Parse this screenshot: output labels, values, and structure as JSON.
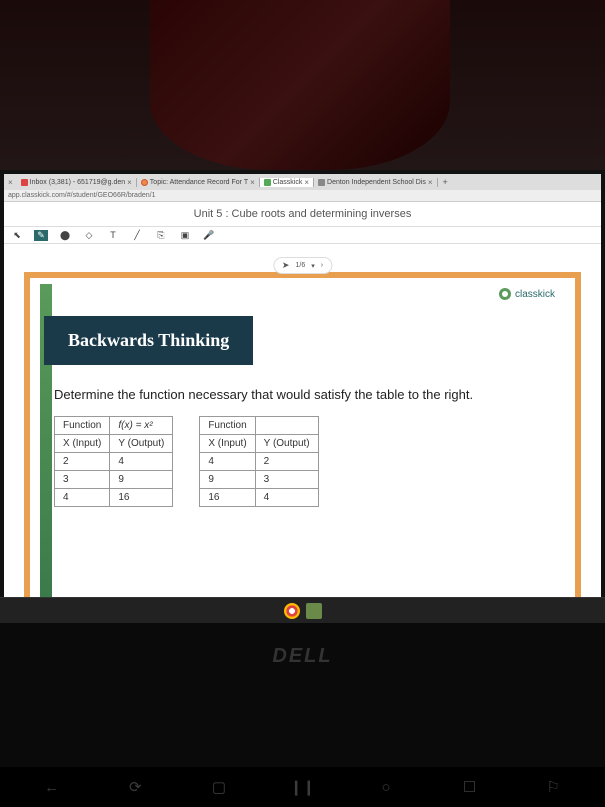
{
  "tabs": {
    "t0": {
      "label": "Inbox (3,381) - 651719@g.den",
      "close": "×"
    },
    "t1": {
      "label": "Topic: Attendance Record For T",
      "close": "×"
    },
    "t2": {
      "label": "Classkick",
      "close": "×"
    },
    "t3": {
      "label": "Denton Independent School Dis",
      "close": "×"
    },
    "plus": "+"
  },
  "url": "app.classkick.com/#/student/GEO66R/braden/1",
  "page_title": "Unit 5 : Cube roots and determining inverses",
  "toolbar": {
    "pointer": "⬉",
    "pen": "✎",
    "highlighter": "⬤",
    "eraser": "◇",
    "text": "T",
    "line": "╱",
    "link": "⎘",
    "image": "▣",
    "mic": "🎤"
  },
  "page_nav": {
    "cursor": "➤",
    "label": "1/6",
    "dropdown": "▾",
    "next": "›"
  },
  "brand": "classkick",
  "slide_title": "Backwards Thinking",
  "prompt": "Determine the function necessary that would satisfy the table to the right.",
  "table_left": {
    "h1": "Function",
    "h2": "f(x) = x²",
    "r1c1": "X (Input)",
    "r1c2": "Y (Output)",
    "r2c1": "2",
    "r2c2": "4",
    "r3c1": "3",
    "r3c2": "9",
    "r4c1": "4",
    "r4c2": "16"
  },
  "table_right": {
    "h1": "Function",
    "h2": "",
    "r1c1": "X (Input)",
    "r1c2": "Y (Output)",
    "r2c1": "4",
    "r2c2": "2",
    "r3c1": "9",
    "r3c2": "3",
    "r4c1": "16",
    "r4c2": "4"
  },
  "dell": "DELL"
}
